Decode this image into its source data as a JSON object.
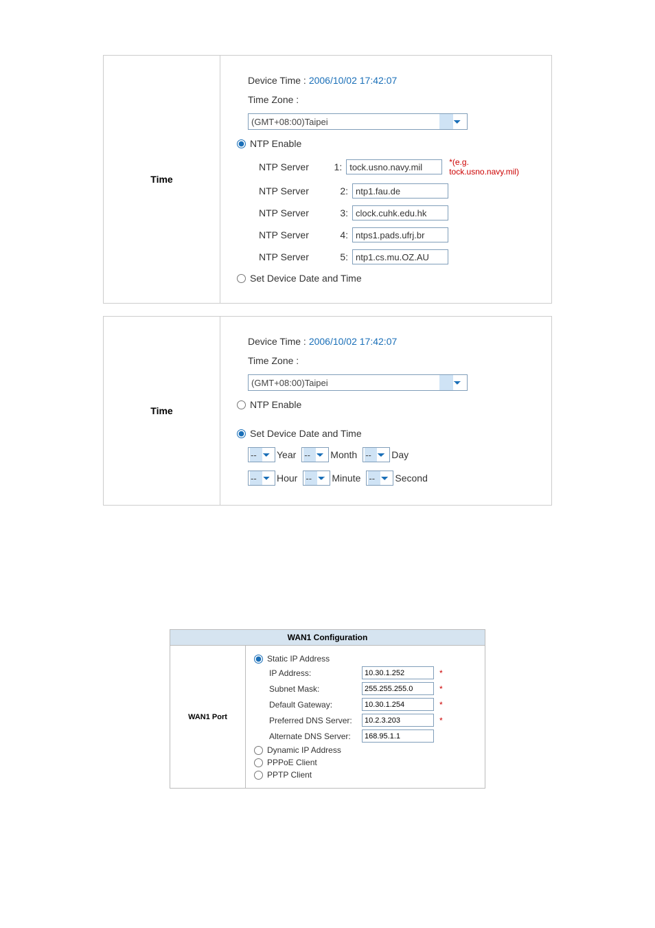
{
  "time1": {
    "section": "Time",
    "device_time_label": "Device Time :",
    "device_time_value": "2006/10/02 17:42:07",
    "tz_label": "Time Zone :",
    "tz_value": "(GMT+08:00)Taipei",
    "ntp_enable_label": "NTP Enable",
    "ntp_servers": [
      {
        "label": "NTP Server",
        "num": "1:",
        "value": "tock.usno.navy.mil",
        "hint": "*(e.g. tock.usno.navy.mil)"
      },
      {
        "label": "NTP Server",
        "num": "2:",
        "value": "ntp1.fau.de"
      },
      {
        "label": "NTP Server",
        "num": "3:",
        "value": "clock.cuhk.edu.hk"
      },
      {
        "label": "NTP Server",
        "num": "4:",
        "value": "ntps1.pads.ufrj.br"
      },
      {
        "label": "NTP Server",
        "num": "5:",
        "value": "ntp1.cs.mu.OZ.AU"
      }
    ],
    "set_date_label": "Set Device Date and Time"
  },
  "time2": {
    "section": "Time",
    "device_time_label": "Device Time :",
    "device_time_value": "2006/10/02 17:42:07",
    "tz_label": "Time Zone :",
    "tz_value": "(GMT+08:00)Taipei",
    "ntp_enable_label": "NTP Enable",
    "set_date_label": "Set Device Date and Time",
    "date_parts": {
      "placeholder": "--",
      "year": "Year",
      "month": "Month",
      "day": "Day",
      "hour": "Hour",
      "minute": "Minute",
      "second": "Second"
    }
  },
  "wan": {
    "title": "WAN1 Configuration",
    "section": "WAN1 Port",
    "static_label": "Static IP Address",
    "fields": {
      "ip_label": "IP Address:",
      "ip_value": "10.30.1.252",
      "mask_label": "Subnet Mask:",
      "mask_value": "255.255.255.0",
      "gw_label": "Default Gateway:",
      "gw_value": "10.30.1.254",
      "pdns_label": "Preferred DNS Server:",
      "pdns_value": "10.2.3.203",
      "adns_label": "Alternate DNS Server:",
      "adns_value": "168.95.1.1"
    },
    "dynamic_label": "Dynamic IP Address",
    "pppoe_label": "PPPoE Client",
    "pptp_label": "PPTP Client",
    "star": "*"
  }
}
